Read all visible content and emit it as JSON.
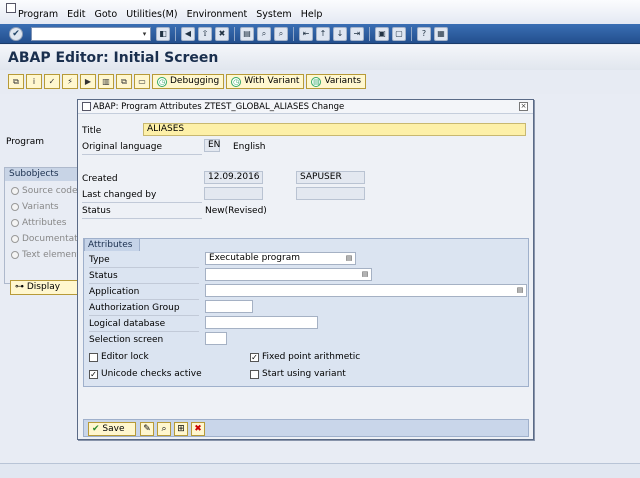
{
  "menubar": {
    "items": [
      "Program",
      "Edit",
      "Goto",
      "Utilities(M)",
      "Environment",
      "System",
      "Help"
    ]
  },
  "systoolbar": {
    "command_value": "",
    "icons": [
      "back-icon",
      "exit-icon",
      "cancel-icon",
      "print-icon",
      "find-icon",
      "find-next-icon",
      "first-page-icon",
      "prev-page-icon",
      "next-page-icon",
      "last-page-icon",
      "new-session-icon",
      "shortcut-icon",
      "help-icon",
      "customize-icon"
    ]
  },
  "title": "ABAP Editor: Initial Screen",
  "apptoolbar": {
    "icons": [
      "where-used-icon",
      "info-icon",
      "check-icon",
      "activate-icon",
      "test-icon",
      "delete-icon",
      "copy-icon",
      "rename-icon"
    ],
    "debugging_label": "Debugging",
    "with_variant_label": "With Variant",
    "variants_label": "Variants"
  },
  "background": {
    "program_label": "Program",
    "subobjects_header": "Subobjects",
    "subobjects": [
      "Source code",
      "Variants",
      "Attributes",
      "Documentation",
      "Text elements"
    ],
    "display_label": "Display"
  },
  "dialog": {
    "title": "ABAP: Program Attributes ZTEST_GLOBAL_ALIASES Change",
    "title_label": "Title",
    "title_value": "ALIASES",
    "orig_lang_label": "Original language",
    "orig_lang_code": "EN",
    "orig_lang_name": "English",
    "created_label": "Created",
    "created_date": "12.09.2016",
    "created_by": "SAPUSER",
    "last_changed_label": "Last changed by",
    "status_label": "Status",
    "status_value": "New(Revised)",
    "attributes": {
      "header": "Attributes",
      "type_label": "Type",
      "type_value": "Executable program",
      "status_label": "Status",
      "status_value": "",
      "application_label": "Application",
      "application_value": "",
      "auth_group_label": "Authorization Group",
      "auth_group_value": "",
      "logical_db_label": "Logical database",
      "logical_db_value": "",
      "selection_screen_label": "Selection screen",
      "selection_screen_value": "",
      "editor_lock_label": "Editor lock",
      "editor_lock_checked": false,
      "fixed_point_label": "Fixed point arithmetic",
      "fixed_point_checked": true,
      "unicode_label": "Unicode checks active",
      "unicode_checked": true,
      "start_variant_label": "Start using variant",
      "start_variant_checked": false
    },
    "footer": {
      "save_label": "Save"
    }
  },
  "colors": {
    "systoolbar": "#2c5ca0",
    "title_field": "#fdf0a8",
    "button_bg": "#fff7cf"
  }
}
